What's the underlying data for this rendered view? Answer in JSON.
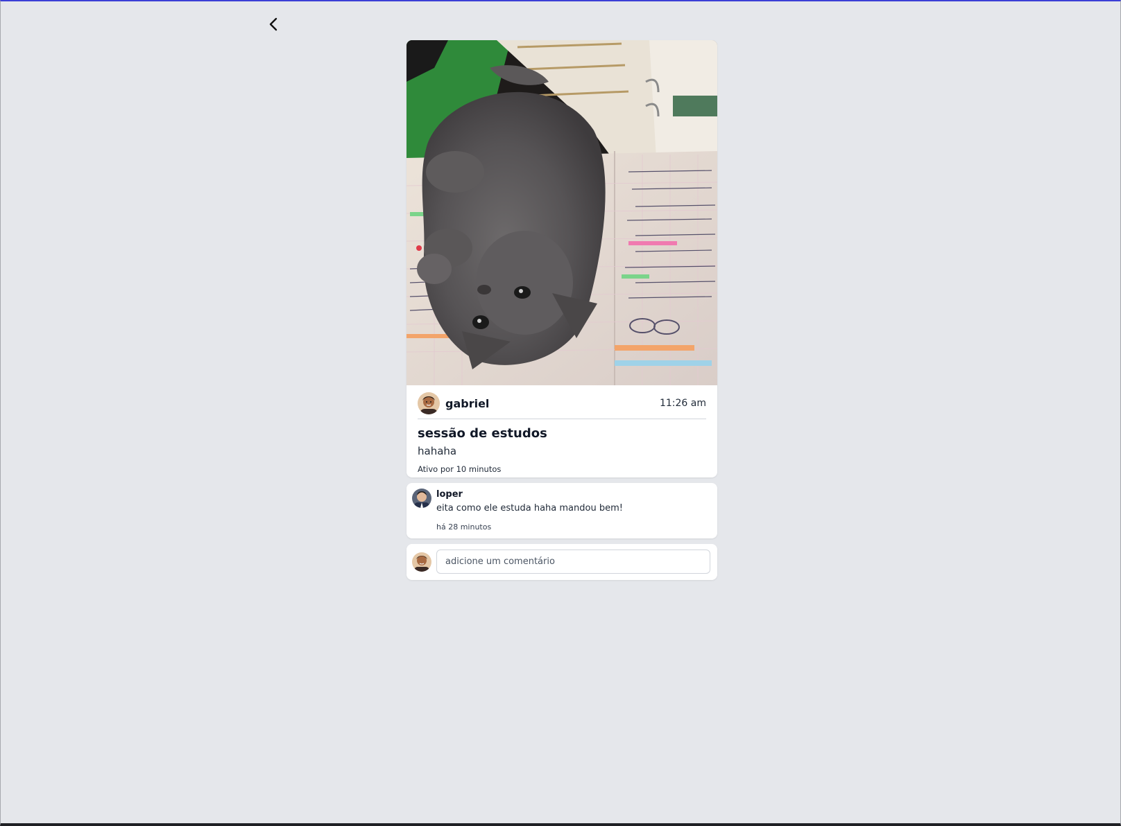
{
  "navigation": {
    "back_icon": "chevron-left-icon"
  },
  "post": {
    "author": "gabriel",
    "time": "11:26 am",
    "title": "sessão de estudos",
    "description": "hahaha",
    "active_text": "Ativo por 10 minutos"
  },
  "comments": [
    {
      "author": "loper",
      "text": "eita como ele estuda haha mandou bem!",
      "time": "há 28 minutos"
    }
  ],
  "comment_input": {
    "placeholder": "adicione um comentário"
  },
  "colors": {
    "background": "#e5e7eb",
    "card": "#ffffff",
    "top_border": "#3b3fd6"
  }
}
